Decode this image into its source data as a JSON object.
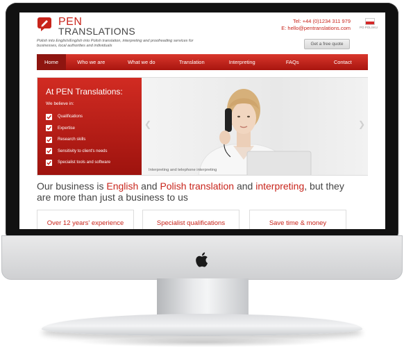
{
  "brand": {
    "name_line1": "PEN",
    "name_line2": "TRANSLATIONS",
    "tagline": "Polish into English/English into Polish translation, interpreting and proofreading services for businesses, local authorities and individuals"
  },
  "contact": {
    "tel": "Tel: +44 (0)1234 311 979",
    "email": "E: hello@pentranslations.com"
  },
  "language": {
    "flag_label": "PO POLSKU"
  },
  "quote_button_label": "Get a free quote",
  "nav": [
    {
      "label": "Home"
    },
    {
      "label": "Who we are"
    },
    {
      "label": "What we do"
    },
    {
      "label": "Translation"
    },
    {
      "label": "Interpreting"
    },
    {
      "label": "FAQs"
    },
    {
      "label": "Contact"
    }
  ],
  "hero": {
    "title": "At PEN Translations:",
    "subtitle": "We believe in:",
    "list": [
      "Qualifications",
      "Expertise",
      "Research skills",
      "Sensitivity to client's needs",
      "Specialist tools and software"
    ],
    "caption": "Interpreting and telephone interpreting"
  },
  "headline": {
    "part1": "Our business is ",
    "english": "English",
    "part2": " and ",
    "polish": "Polish translation",
    "part3": " and ",
    "interpreting": "interpreting",
    "part4": ", but they are more than just a business to us"
  },
  "cards": [
    {
      "label": "Over 12 years' experience"
    },
    {
      "label": "Specialist qualifications"
    },
    {
      "label": "Save time & money"
    }
  ],
  "colors": {
    "brand_red": "#c8241b",
    "nav_active": "#8e1510"
  }
}
